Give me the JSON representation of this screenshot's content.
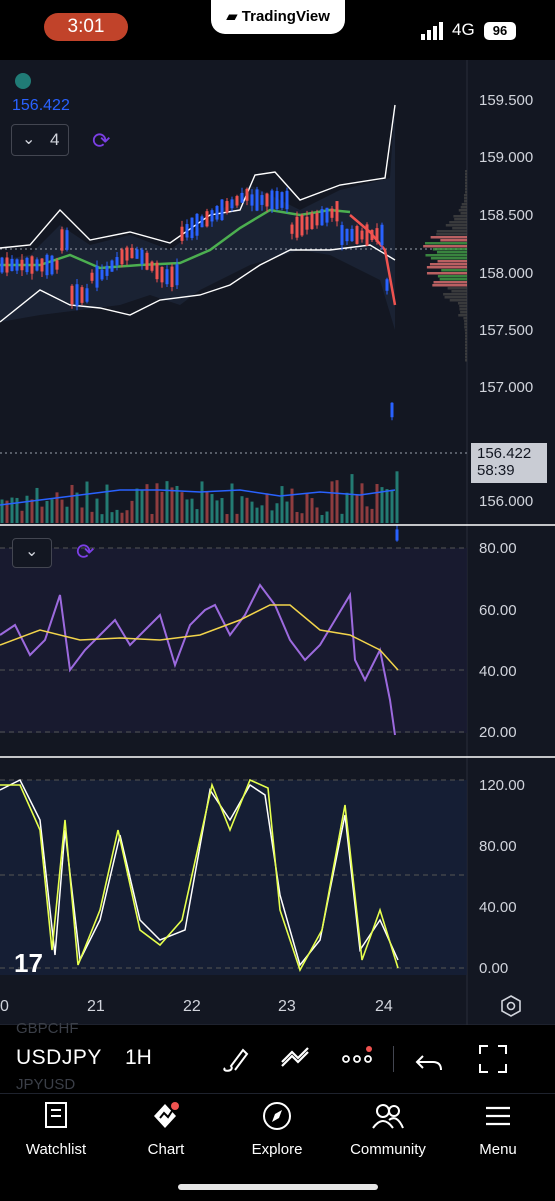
{
  "status_bar": {
    "time": "3:01",
    "network": "4G",
    "battery": "96",
    "app_banner": "TradingView"
  },
  "chart": {
    "last_price_label": "156.422",
    "indicator_count": "4",
    "price_axis": [
      "159.500",
      "159.000",
      "158.500",
      "158.000",
      "157.500",
      "157.000",
      "156.000"
    ],
    "price_tag": {
      "price": "156.422",
      "countdown": "58:39"
    },
    "rsi_axis": [
      "80.00",
      "60.00",
      "40.00",
      "20.00"
    ],
    "stoch_axis": [
      "120.00",
      "80.00",
      "40.00",
      "0.00"
    ],
    "date_axis": [
      "0",
      "21",
      "22",
      "23",
      "24"
    ],
    "colors": {
      "up": "#2962ff",
      "down": "#ef5350",
      "rsi": "#9c6ade",
      "rsi_ma": "#f2d44b",
      "stoch_k": "#e6ff4d",
      "stoch_d": "#ffffff"
    }
  },
  "toolbar": {
    "symbol": "USDJPY",
    "interval": "1H",
    "ghost_symbol_above": "GBPCHF",
    "ghost_symbol_below": "JPYUSD"
  },
  "tabs": [
    {
      "label": "Watchlist",
      "icon": "watchlist-icon"
    },
    {
      "label": "Chart",
      "icon": "chart-icon"
    },
    {
      "label": "Explore",
      "icon": "compass-icon"
    },
    {
      "label": "Community",
      "icon": "community-icon"
    },
    {
      "label": "Menu",
      "icon": "menu-icon"
    }
  ]
}
